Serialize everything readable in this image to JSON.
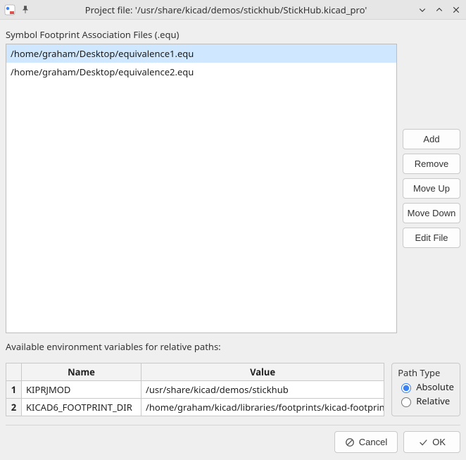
{
  "window": {
    "title": "Project file: '/usr/share/kicad/demos/stickhub/StickHub.kicad_pro'"
  },
  "labels": {
    "files_section": "Symbol Footprint Association Files (.equ)",
    "env_section": "Available environment variables for relative paths:"
  },
  "files": {
    "items": [
      {
        "path": "/home/graham/Desktop/equivalence1.equ",
        "selected": true
      },
      {
        "path": "/home/graham/Desktop/equivalence2.equ",
        "selected": false
      }
    ]
  },
  "side_buttons": {
    "add": "Add",
    "remove": "Remove",
    "move_up": "Move Up",
    "move_down": "Move Down",
    "edit_file": "Edit File"
  },
  "env_table": {
    "headers": {
      "name": "Name",
      "value": "Value"
    },
    "rows": [
      {
        "num": "1",
        "name": "KIPRJMOD",
        "value": "/usr/share/kicad/demos/stickhub"
      },
      {
        "num": "2",
        "name": "KICAD6_FOOTPRINT_DIR",
        "value": "/home/graham/kicad/libraries/footprints/kicad-footprints"
      }
    ]
  },
  "path_type": {
    "legend": "Path Type",
    "absolute": "Absolute",
    "relative": "Relative",
    "selected": "absolute"
  },
  "bottom": {
    "cancel": "Cancel",
    "ok": "OK"
  }
}
